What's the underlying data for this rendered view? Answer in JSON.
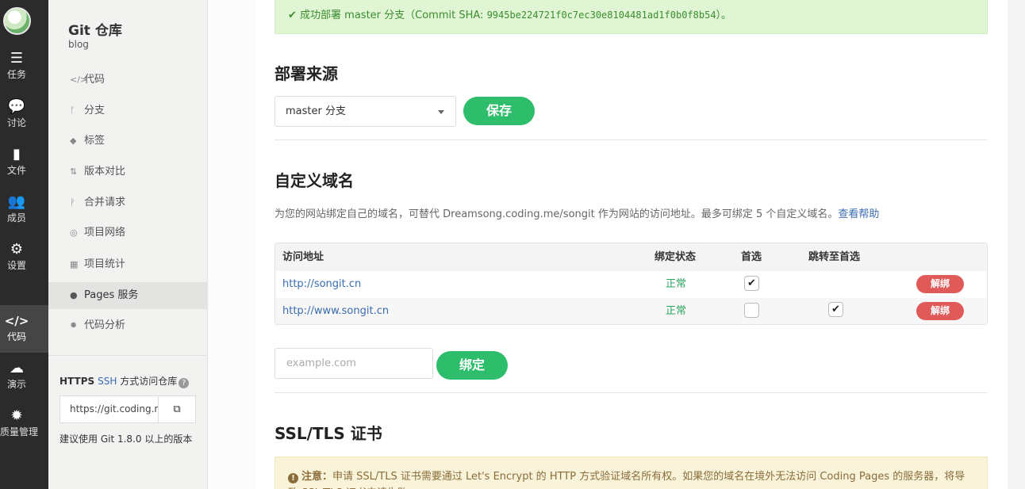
{
  "rail": {
    "items": [
      {
        "label": "任务",
        "icon": "tasks-icon",
        "glyph": "☰"
      },
      {
        "label": "讨论",
        "icon": "discussion-icon",
        "glyph": "💬"
      },
      {
        "label": "文件",
        "icon": "file-icon",
        "glyph": "▮"
      },
      {
        "label": "成员",
        "icon": "members-icon",
        "glyph": "👥"
      },
      {
        "label": "设置",
        "icon": "settings-icon",
        "glyph": "⚙"
      },
      {
        "label": "代码",
        "icon": "code-icon",
        "glyph": "</>"
      },
      {
        "label": "演示",
        "icon": "cloud-icon",
        "glyph": "☁"
      },
      {
        "label": "质量管理",
        "icon": "quality-icon",
        "glyph": "✹"
      }
    ]
  },
  "sidebar": {
    "title": "Git 仓库",
    "subtitle": "blog",
    "items": [
      {
        "label": "代码",
        "glyph": "</>"
      },
      {
        "label": "分支",
        "glyph": "ᚴ"
      },
      {
        "label": "标签",
        "glyph": "◆"
      },
      {
        "label": "版本对比",
        "glyph": "⇅"
      },
      {
        "label": "合并请求",
        "glyph": "ᚹ"
      },
      {
        "label": "项目网络",
        "glyph": "◎"
      },
      {
        "label": "项目统计",
        "glyph": "▦"
      },
      {
        "label": "Pages 服务",
        "glyph": "●"
      },
      {
        "label": "代码分析",
        "glyph": "✹"
      }
    ],
    "clone": {
      "https_label": "HTTPS",
      "ssh_label": "SSH",
      "suffix": "方式访问仓库",
      "help_glyph": "?",
      "url": "https://git.coding.net/",
      "copy_glyph": "⧉",
      "note": "建议使用 Git 1.8.0 以上的版本"
    }
  },
  "main": {
    "success": {
      "check": "✔",
      "text_prefix": "成功部署 master 分支（Commit SHA: ",
      "sha": "9945be224721f0c7ec30e8104481ad1f0b0f8b54",
      "text_suffix": "）。"
    },
    "deploy_source": {
      "heading": "部署来源",
      "selected": "master 分支",
      "save_label": "保存"
    },
    "custom_domain": {
      "heading": "自定义域名",
      "desc": "为您的网站绑定自己的域名，可替代 Dreamsong.coding.me/songit 作为网站的访问地址。最多可绑定 5 个自定义域名。",
      "help_link": "查看帮助",
      "columns": [
        "访问地址",
        "绑定状态",
        "首选",
        "跳转至首选"
      ],
      "rows": [
        {
          "url": "http://songit.cn",
          "status": "正常",
          "preferred": "✔",
          "redirect": "",
          "action": "解绑"
        },
        {
          "url": "http://www.songit.cn",
          "status": "正常",
          "preferred": "",
          "redirect": "✔",
          "action": "解绑"
        }
      ],
      "input_placeholder": "example.com",
      "bind_label": "绑定"
    },
    "ssl": {
      "heading": "SSL/TLS 证书",
      "notice_label": "注意：",
      "notice_text": "申请 SSL/TLS 证书需要通过 Let's Encrypt 的 HTTP 方式验证域名所有权。如果您的域名在境外无法访问 Coding Pages 的服务器，将导致 SSL/TLS 证书申请失败。",
      "notice_glyph": "!"
    }
  },
  "colors": {
    "accent_green": "#2ebd6b",
    "danger_red": "#e05a5a",
    "link_blue": "#3a6cb0",
    "rail_bg": "#2b2b2b"
  }
}
